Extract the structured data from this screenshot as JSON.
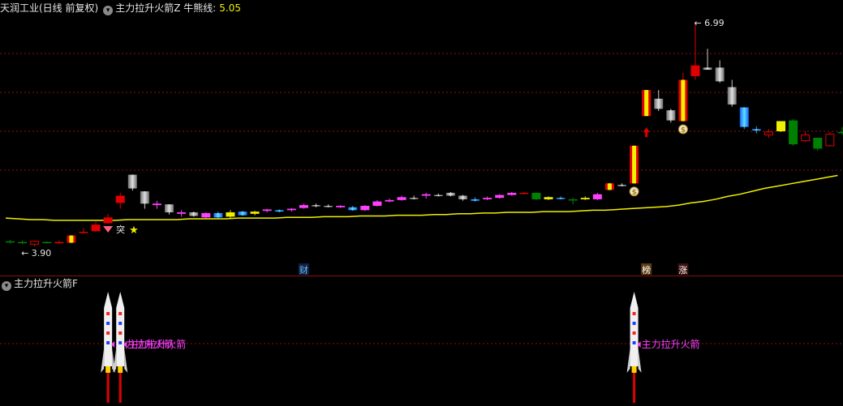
{
  "main_panel": {
    "stock_title": "天润工业(日线 前复权)",
    "indicator_name": "主力拉升火箭Z",
    "bull_bear_label": "牛熊线:",
    "bull_bear_value": "5.05",
    "high_label": "6.99",
    "low_label": "3.90",
    "breakout_label": "突",
    "event_markers": [
      "财",
      "榜",
      "涨"
    ]
  },
  "sub_panel": {
    "indicator_name": "主力拉升火箭F",
    "rocket_labels": [
      "主力拉升火箭",
      "主力拉升火箭",
      "主力拉升火箭"
    ]
  },
  "colors": {
    "up": "#e00000",
    "down": "#008000",
    "yellow_line": "#f0f000",
    "magenta": "#ff40ff",
    "cyan": "#1ea0ff",
    "gray": "#a0a0a0",
    "grid": "#8b1010"
  },
  "chart_data": {
    "type": "candlestick",
    "price_range": [
      3.9,
      6.99
    ],
    "candles": [
      {
        "o": 3.96,
        "h": 3.99,
        "l": 3.94,
        "c": 3.97,
        "s": "down"
      },
      {
        "o": 3.96,
        "h": 3.98,
        "l": 3.93,
        "c": 3.95,
        "s": "down"
      },
      {
        "o": 3.93,
        "h": 3.98,
        "l": 3.9,
        "c": 3.97,
        "s": "hollow"
      },
      {
        "o": 3.95,
        "h": 3.97,
        "l": 3.94,
        "c": 3.96,
        "s": "down"
      },
      {
        "o": 3.95,
        "h": 3.98,
        "l": 3.94,
        "c": 3.96,
        "s": "up"
      },
      {
        "o": 3.95,
        "h": 4.06,
        "l": 3.94,
        "c": 4.05,
        "s": "rocket"
      },
      {
        "o": 4.09,
        "h": 4.15,
        "l": 4.08,
        "c": 4.1,
        "s": "up"
      },
      {
        "o": 4.11,
        "h": 4.24,
        "l": 4.1,
        "c": 4.2,
        "s": "up"
      },
      {
        "o": 4.22,
        "h": 4.35,
        "l": 4.21,
        "c": 4.3,
        "s": "up"
      },
      {
        "o": 4.5,
        "h": 4.64,
        "l": 4.42,
        "c": 4.6,
        "s": "up"
      },
      {
        "o": 4.89,
        "h": 4.89,
        "l": 4.67,
        "c": 4.7,
        "s": "gray"
      },
      {
        "o": 4.66,
        "h": 4.66,
        "l": 4.42,
        "c": 4.49,
        "s": "gray"
      },
      {
        "o": 4.49,
        "h": 4.53,
        "l": 4.42,
        "c": 4.47,
        "s": "magenta"
      },
      {
        "o": 4.48,
        "h": 4.48,
        "l": 4.34,
        "c": 4.37,
        "s": "gray"
      },
      {
        "o": 4.37,
        "h": 4.4,
        "l": 4.31,
        "c": 4.35,
        "s": "magenta"
      },
      {
        "o": 4.37,
        "h": 4.38,
        "l": 4.31,
        "c": 4.32,
        "s": "gray"
      },
      {
        "o": 4.36,
        "h": 4.37,
        "l": 4.29,
        "c": 4.3,
        "s": "magenta"
      },
      {
        "o": 4.36,
        "h": 4.38,
        "l": 4.29,
        "c": 4.3,
        "s": "cyan"
      },
      {
        "o": 4.31,
        "h": 4.4,
        "l": 4.28,
        "c": 4.37,
        "s": "yellow"
      },
      {
        "o": 4.33,
        "h": 4.39,
        "l": 4.32,
        "c": 4.38,
        "s": "cyan"
      },
      {
        "o": 4.35,
        "h": 4.39,
        "l": 4.33,
        "c": 4.38,
        "s": "yellow"
      },
      {
        "o": 4.39,
        "h": 4.42,
        "l": 4.37,
        "c": 4.41,
        "s": "magenta"
      },
      {
        "o": 4.38,
        "h": 4.41,
        "l": 4.37,
        "c": 4.4,
        "s": "cyan"
      },
      {
        "o": 4.4,
        "h": 4.43,
        "l": 4.38,
        "c": 4.42,
        "s": "magenta"
      },
      {
        "o": 4.43,
        "h": 4.49,
        "l": 4.42,
        "c": 4.47,
        "s": "magenta"
      },
      {
        "o": 4.47,
        "h": 4.49,
        "l": 4.44,
        "c": 4.46,
        "s": "gray"
      },
      {
        "o": 4.46,
        "h": 4.48,
        "l": 4.44,
        "c": 4.45,
        "s": "gray"
      },
      {
        "o": 4.44,
        "h": 4.47,
        "l": 4.43,
        "c": 4.46,
        "s": "magenta"
      },
      {
        "o": 4.44,
        "h": 4.46,
        "l": 4.39,
        "c": 4.4,
        "s": "cyan"
      },
      {
        "o": 4.4,
        "h": 4.47,
        "l": 4.39,
        "c": 4.46,
        "s": "magenta"
      },
      {
        "o": 4.46,
        "h": 4.54,
        "l": 4.45,
        "c": 4.52,
        "s": "magenta"
      },
      {
        "o": 4.52,
        "h": 4.56,
        "l": 4.51,
        "c": 4.54,
        "s": "magenta"
      },
      {
        "o": 4.54,
        "h": 4.6,
        "l": 4.53,
        "c": 4.58,
        "s": "magenta"
      },
      {
        "o": 4.56,
        "h": 4.6,
        "l": 4.55,
        "c": 4.57,
        "s": "gray"
      },
      {
        "o": 4.6,
        "h": 4.64,
        "l": 4.56,
        "c": 4.62,
        "s": "magenta"
      },
      {
        "o": 4.6,
        "h": 4.63,
        "l": 4.59,
        "c": 4.61,
        "s": "gray"
      },
      {
        "o": 4.64,
        "h": 4.65,
        "l": 4.59,
        "c": 4.6,
        "s": "gray"
      },
      {
        "o": 4.6,
        "h": 4.61,
        "l": 4.53,
        "c": 4.55,
        "s": "gray"
      },
      {
        "o": 4.55,
        "h": 4.58,
        "l": 4.52,
        "c": 4.53,
        "s": "cyan"
      },
      {
        "o": 4.55,
        "h": 4.59,
        "l": 4.54,
        "c": 4.57,
        "s": "magenta"
      },
      {
        "o": 4.57,
        "h": 4.62,
        "l": 4.56,
        "c": 4.61,
        "s": "magenta"
      },
      {
        "o": 4.61,
        "h": 4.65,
        "l": 4.6,
        "c": 4.64,
        "s": "magenta"
      },
      {
        "o": 4.63,
        "h": 4.65,
        "l": 4.62,
        "c": 4.64,
        "s": "up"
      },
      {
        "o": 4.64,
        "h": 4.64,
        "l": 4.54,
        "c": 4.55,
        "s": "down"
      },
      {
        "o": 4.58,
        "h": 4.59,
        "l": 4.54,
        "c": 4.55,
        "s": "yellow"
      },
      {
        "o": 4.57,
        "h": 4.59,
        "l": 4.55,
        "c": 4.56,
        "s": "cyan"
      },
      {
        "o": 4.55,
        "h": 4.57,
        "l": 4.48,
        "c": 4.55,
        "s": "down"
      },
      {
        "o": 4.55,
        "h": 4.59,
        "l": 4.54,
        "c": 4.57,
        "s": "yellow"
      },
      {
        "o": 4.55,
        "h": 4.64,
        "l": 4.54,
        "c": 4.62,
        "s": "magenta"
      },
      {
        "o": 4.68,
        "h": 4.78,
        "l": 4.67,
        "c": 4.77,
        "s": "rocket"
      },
      {
        "o": 4.75,
        "h": 4.77,
        "l": 4.73,
        "c": 4.75,
        "s": "gray"
      },
      {
        "o": 4.77,
        "h": 5.3,
        "l": 4.76,
        "c": 5.29,
        "s": "rocket"
      },
      {
        "o": 5.7,
        "h": 6.06,
        "l": 5.7,
        "c": 6.06,
        "s": "rocket"
      },
      {
        "o": 5.94,
        "h": 6.06,
        "l": 5.77,
        "c": 5.8,
        "s": "gray"
      },
      {
        "o": 5.78,
        "h": 5.8,
        "l": 5.61,
        "c": 5.64,
        "s": "gray"
      },
      {
        "o": 5.63,
        "h": 6.3,
        "l": 5.62,
        "c": 6.2,
        "s": "rocket"
      },
      {
        "o": 6.25,
        "h": 6.99,
        "l": 6.2,
        "c": 6.4,
        "s": "up"
      },
      {
        "o": 6.37,
        "h": 6.63,
        "l": 6.36,
        "c": 6.34,
        "s": "gray"
      },
      {
        "o": 6.37,
        "h": 6.47,
        "l": 6.16,
        "c": 6.18,
        "s": "gray"
      },
      {
        "o": 6.1,
        "h": 6.2,
        "l": 5.83,
        "c": 5.86,
        "s": "gray"
      },
      {
        "o": 5.82,
        "h": 5.82,
        "l": 5.52,
        "c": 5.55,
        "s": "cyan"
      },
      {
        "o": 5.52,
        "h": 5.56,
        "l": 5.46,
        "c": 5.5,
        "s": "cyan"
      },
      {
        "o": 5.44,
        "h": 5.52,
        "l": 5.4,
        "c": 5.48,
        "s": "hollow"
      },
      {
        "o": 5.49,
        "h": 5.63,
        "l": 5.48,
        "c": 5.63,
        "s": "yellow"
      },
      {
        "o": 5.64,
        "h": 5.66,
        "l": 5.29,
        "c": 5.31,
        "s": "down"
      },
      {
        "o": 5.36,
        "h": 5.49,
        "l": 5.34,
        "c": 5.44,
        "s": "hollow"
      },
      {
        "o": 5.4,
        "h": 5.4,
        "l": 5.22,
        "c": 5.25,
        "s": "down"
      },
      {
        "o": 5.29,
        "h": 5.48,
        "l": 5.28,
        "c": 5.45,
        "s": "hollow"
      },
      {
        "o": 5.48,
        "h": 5.55,
        "l": 5.44,
        "c": 5.48,
        "s": "down"
      }
    ],
    "bull_bear_line": [
      4.29,
      4.28,
      4.27,
      4.27,
      4.26,
      4.26,
      4.26,
      4.26,
      4.26,
      4.26,
      4.27,
      4.27,
      4.27,
      4.27,
      4.27,
      4.28,
      4.28,
      4.28,
      4.28,
      4.29,
      4.29,
      4.29,
      4.29,
      4.3,
      4.3,
      4.3,
      4.31,
      4.31,
      4.31,
      4.32,
      4.32,
      4.32,
      4.33,
      4.33,
      4.33,
      4.34,
      4.34,
      4.35,
      4.35,
      4.36,
      4.36,
      4.37,
      4.37,
      4.37,
      4.38,
      4.38,
      4.38,
      4.39,
      4.4,
      4.4,
      4.41,
      4.42,
      4.43,
      4.44,
      4.45,
      4.47,
      4.5,
      4.52,
      4.55,
      4.59,
      4.62,
      4.66,
      4.7,
      4.73,
      4.76,
      4.79,
      4.82,
      4.85,
      4.88
    ]
  }
}
